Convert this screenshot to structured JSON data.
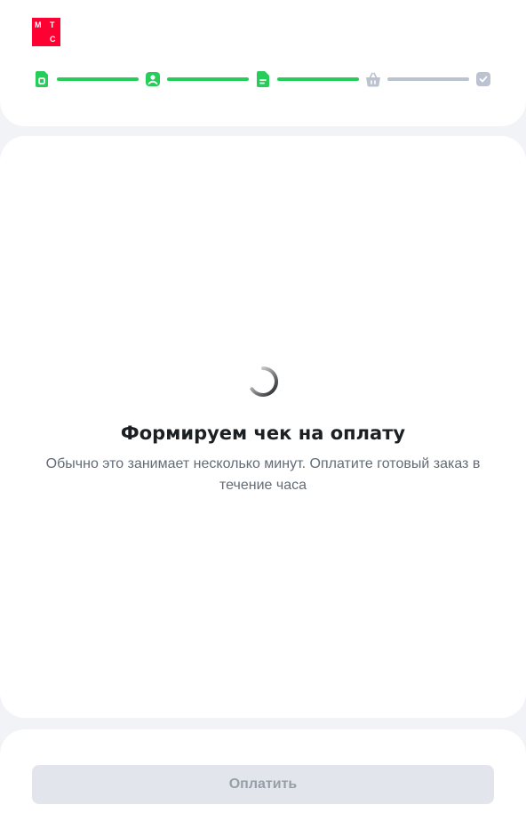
{
  "logo": {
    "letters": [
      "М",
      "Т",
      "С"
    ],
    "color": "#ff0032"
  },
  "stepper": {
    "steps": [
      {
        "icon": "sim-card-icon",
        "status": "done"
      },
      {
        "icon": "user-profile-icon",
        "status": "done"
      },
      {
        "icon": "document-icon",
        "status": "done"
      },
      {
        "icon": "shopping-basket-icon",
        "status": "pending"
      },
      {
        "icon": "checkmark-icon",
        "status": "pending"
      }
    ],
    "active_color": "#26cd58",
    "inactive_color": "#bcc3d0"
  },
  "loading": {
    "title": "Формируем чек на оплату",
    "subtitle": "Обычно это занимает несколько минут. Оплатите готовый заказ в течение часа"
  },
  "footer": {
    "pay_button_label": "Оплатить"
  }
}
